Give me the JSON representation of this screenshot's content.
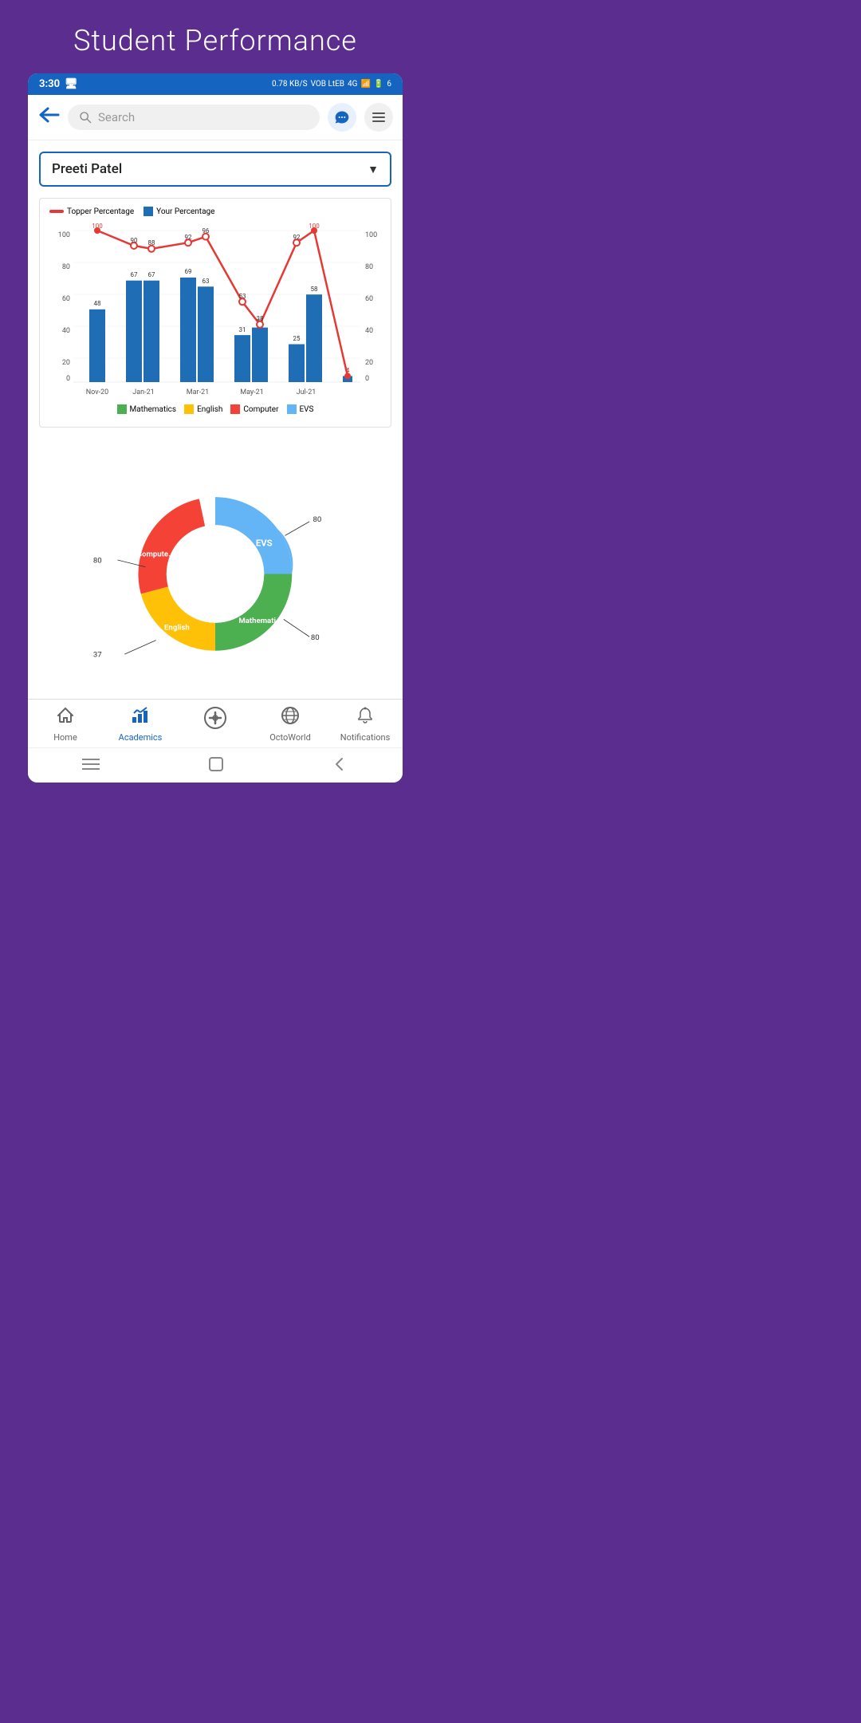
{
  "page": {
    "title": "Student Performance",
    "bg_color": "#5b2d8e"
  },
  "status_bar": {
    "time": "3:30",
    "network": "0.78 KB/S",
    "network2": "VOB LtEB",
    "signal": "4G",
    "battery": "6"
  },
  "top_nav": {
    "search_placeholder": "Search",
    "back_icon": "←",
    "chat_icon": "💬",
    "menu_icon": "≡"
  },
  "student_selector": {
    "name": "Preeti Patel",
    "arrow": "▼"
  },
  "bar_chart": {
    "legend": [
      {
        "label": "Topper Percentage",
        "color": "#e53935",
        "type": "line"
      },
      {
        "label": "Your Percentage",
        "color": "#1e6db5",
        "type": "bar"
      }
    ],
    "y_labels": [
      "100",
      "80",
      "60",
      "40",
      "20",
      "0"
    ],
    "months": [
      "Nov-20",
      "Jan-21",
      "Mar-21",
      "May-21",
      "Jul-21"
    ],
    "bars": [
      {
        "month": "Nov-20",
        "value": 48,
        "topper": 100
      },
      {
        "month": "Jan-21",
        "value": 67,
        "topper": 90
      },
      {
        "month": "Jan-21b",
        "value": 67,
        "topper": 88
      },
      {
        "month": "Mar-21",
        "value": 69,
        "topper": 92
      },
      {
        "month": "Mar-21b",
        "value": 63,
        "topper": 96
      },
      {
        "month": "May-21",
        "value": 31,
        "topper": 53
      },
      {
        "month": "May-21b",
        "value": 36,
        "topper": 38
      },
      {
        "month": "Jul-21",
        "value": 25,
        "topper": 92
      },
      {
        "month": "Jul-21b",
        "value": 58,
        "topper": 100
      },
      {
        "month": "end",
        "value": 4,
        "topper": 4
      }
    ],
    "bottom_legend": [
      {
        "label": "Mathematics",
        "color": "#4caf50"
      },
      {
        "label": "English",
        "color": "#ffc107"
      },
      {
        "label": "Computer",
        "color": "#f44336"
      },
      {
        "label": "EVS",
        "color": "#64b5f6"
      }
    ]
  },
  "donut_chart": {
    "segments": [
      {
        "label": "EVS",
        "value": 80,
        "color": "#64b5f6",
        "angle_start": 0,
        "angle_end": 90
      },
      {
        "label": "Mathematics",
        "value": 80,
        "color": "#4caf50",
        "angle_start": 90,
        "angle_end": 180
      },
      {
        "label": "English",
        "value": 37,
        "color": "#ffc107",
        "angle_start": 180,
        "angle_end": 250
      },
      {
        "label": "Computer",
        "value": 80,
        "color": "#f44336",
        "angle_start": 250,
        "angle_end": 340
      }
    ],
    "labels": {
      "evs_val": "80",
      "math_val": "80",
      "english_val": "37",
      "computer_val": "80",
      "evs_label": "EVS",
      "math_label": "Mathemati...",
      "english_label": "English",
      "computer_label": "Compute..."
    }
  },
  "bottom_nav": {
    "items": [
      {
        "label": "Home",
        "icon": "🏠",
        "active": false
      },
      {
        "label": "Academics",
        "icon": "📐",
        "active": true
      },
      {
        "label": "",
        "icon": "🛡",
        "active": false,
        "center": true
      },
      {
        "label": "OctoWorld",
        "icon": "🌐",
        "active": false
      },
      {
        "label": "Notifications",
        "icon": "🔔",
        "active": false
      }
    ]
  }
}
